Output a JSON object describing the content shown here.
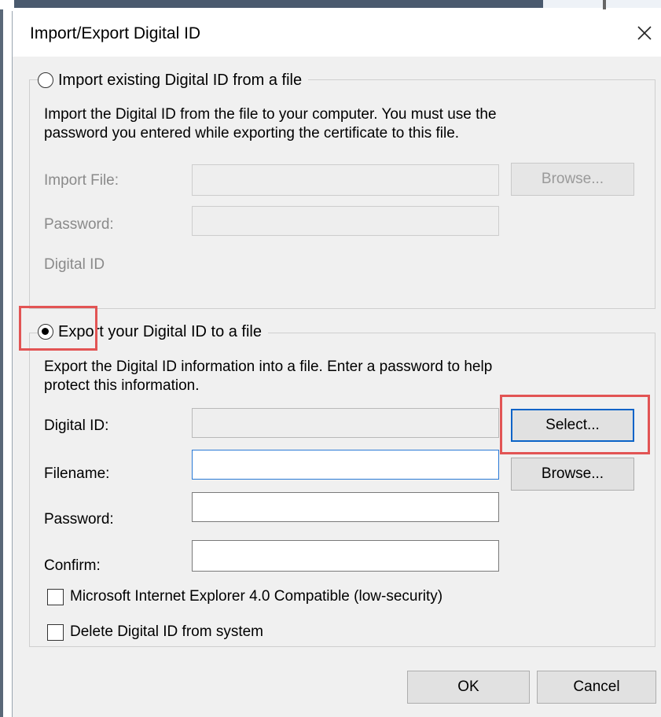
{
  "window": {
    "title": "Import/Export Digital ID"
  },
  "import_group": {
    "radio_label": "Import existing Digital ID from a file",
    "selected": false,
    "description_line1": "Import the Digital ID from the file to your computer. You must use the",
    "description_line2": "password you entered while exporting the certificate to this file.",
    "import_file_label": "Import File:",
    "import_file_value": "",
    "browse_label": "Browse...",
    "password_label": "Password:",
    "password_value": "",
    "digital_id_label": "Digital ID"
  },
  "export_group": {
    "radio_label": "Export your Digital ID to a file",
    "selected": true,
    "description_line1": "Export the Digital ID information into a file. Enter a password to help",
    "description_line2": "protect this information.",
    "digital_id_label": "Digital ID:",
    "digital_id_value": "",
    "select_label": "Select...",
    "filename_label": "Filename:",
    "filename_value": "",
    "browse_label": "Browse...",
    "password_label": "Password:",
    "password_value": "",
    "confirm_label": "Confirm:",
    "confirm_value": ""
  },
  "options": {
    "ie4_compat_label": "Microsoft Internet Explorer 4.0 Compatible (low-security)",
    "ie4_compat_checked": false,
    "delete_label": "Delete Digital ID from system",
    "delete_checked": false
  },
  "buttons": {
    "ok": "OK",
    "cancel": "Cancel"
  },
  "colors": {
    "highlight": "#e25454",
    "focus_blue": "#0a64c8",
    "dialog_bg": "#f0f0f0"
  }
}
